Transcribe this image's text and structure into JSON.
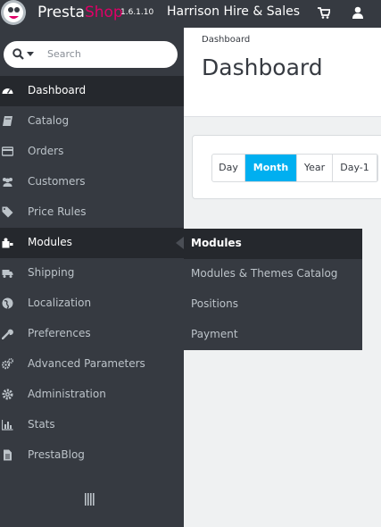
{
  "header": {
    "brand_part1": "Presta",
    "brand_part2": "Shop",
    "version": "1.6.1.10",
    "shop_name": "Harrison Hire & Sales",
    "icons": [
      "cart-icon",
      "user-icon"
    ]
  },
  "search": {
    "placeholder": "Search"
  },
  "sidebar": {
    "items": [
      {
        "label": "Dashboard",
        "icon": "dashboard-icon"
      },
      {
        "label": "Catalog",
        "icon": "book-icon"
      },
      {
        "label": "Orders",
        "icon": "credit-card-icon"
      },
      {
        "label": "Customers",
        "icon": "users-icon"
      },
      {
        "label": "Price Rules",
        "icon": "tags-icon"
      },
      {
        "label": "Modules",
        "icon": "puzzle-icon"
      },
      {
        "label": "Shipping",
        "icon": "truck-icon"
      },
      {
        "label": "Localization",
        "icon": "globe-icon"
      },
      {
        "label": "Preferences",
        "icon": "wrench-icon"
      },
      {
        "label": "Advanced Parameters",
        "icon": "cogs-icon"
      },
      {
        "label": "Administration",
        "icon": "cog-icon"
      },
      {
        "label": "Stats",
        "icon": "bar-chart-icon"
      },
      {
        "label": "PrestaBlog",
        "icon": "file-text-icon"
      }
    ]
  },
  "submenu": {
    "items": [
      {
        "label": "Modules"
      },
      {
        "label": "Modules & Themes Catalog"
      },
      {
        "label": "Positions"
      },
      {
        "label": "Payment"
      }
    ]
  },
  "main": {
    "breadcrumb": "Dashboard",
    "title": "Dashboard",
    "range_buttons": [
      {
        "label": "Day"
      },
      {
        "label": "Month"
      },
      {
        "label": "Year"
      },
      {
        "label": "Day-1"
      }
    ]
  },
  "colors": {
    "sidebar_bg": "#363a41",
    "sidebar_active": "#25282d",
    "accent_blue": "#00aff0",
    "brand_pink": "#df0067"
  }
}
